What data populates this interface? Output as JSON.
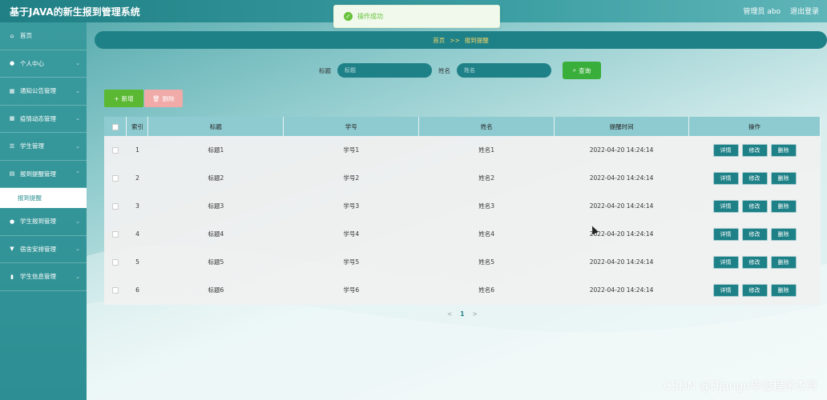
{
  "header": {
    "app_title": "基于JAVA的新生报到管理系统",
    "admin_label": "管理员 abo",
    "logout_label": "退出登录"
  },
  "toast": {
    "message": "操作成功",
    "icon": "check-circle-icon",
    "color": "#67c23a"
  },
  "sidebar": {
    "items": [
      {
        "label": "首页",
        "icon": "home-icon"
      },
      {
        "label": "个人中心",
        "icon": "user-icon"
      },
      {
        "label": "通知公告管理",
        "icon": "grid-icon"
      },
      {
        "label": "疫情动态管理",
        "icon": "grid-icon"
      },
      {
        "label": "学生管理",
        "icon": "list-icon"
      },
      {
        "label": "报到提醒管理",
        "icon": "file-icon"
      },
      {
        "label": "报到提醒",
        "icon": "",
        "active": true
      },
      {
        "label": "学生报到管理",
        "icon": "user-icon"
      },
      {
        "label": "宿舍安排管理",
        "icon": "filter-icon"
      },
      {
        "label": "学生信息管理",
        "icon": "bar-chart-icon"
      }
    ]
  },
  "breadcrumb": {
    "home": "首页",
    "sep": ">>",
    "current": "报到提醒"
  },
  "search": {
    "title_label": "标题",
    "title_placeholder": "标题",
    "name_label": "姓名",
    "name_placeholder": "姓名",
    "button_label": "查询"
  },
  "actions": {
    "add_label": "新增",
    "delete_label": "删除"
  },
  "table": {
    "columns": [
      "索引",
      "标题",
      "学号",
      "姓名",
      "提醒时间",
      "操作"
    ],
    "rows": [
      {
        "index": "1",
        "title": "标题1",
        "sid": "学号1",
        "name": "姓名1",
        "time": "2022-04-20 14:24:14"
      },
      {
        "index": "2",
        "title": "标题2",
        "sid": "学号2",
        "name": "姓名2",
        "time": "2022-04-20 14:24:14"
      },
      {
        "index": "3",
        "title": "标题3",
        "sid": "学号3",
        "name": "姓名3",
        "time": "2022-04-20 14:24:14"
      },
      {
        "index": "4",
        "title": "标题4",
        "sid": "学号4",
        "name": "姓名4",
        "time": "2022-04-20 14:24:14"
      },
      {
        "index": "5",
        "title": "标题5",
        "sid": "学号5",
        "name": "姓名5",
        "time": "2022-04-20 14:24:14"
      },
      {
        "index": "6",
        "title": "标题6",
        "sid": "学号6",
        "name": "姓名6",
        "time": "2022-04-20 14:24:14"
      }
    ],
    "row_actions": {
      "detail": "详情",
      "edit": "修改",
      "delete": "删除"
    }
  },
  "pager": {
    "prev": "<",
    "current": "1",
    "next": ">"
  },
  "watermark": "CSDN @Django毕设程序杰哥",
  "colors": {
    "primary": "#1e8187",
    "header_row": "#8ecbd0",
    "add": "#5ab832",
    "delete": "#f0aaa8",
    "search": "#3aae3a"
  }
}
